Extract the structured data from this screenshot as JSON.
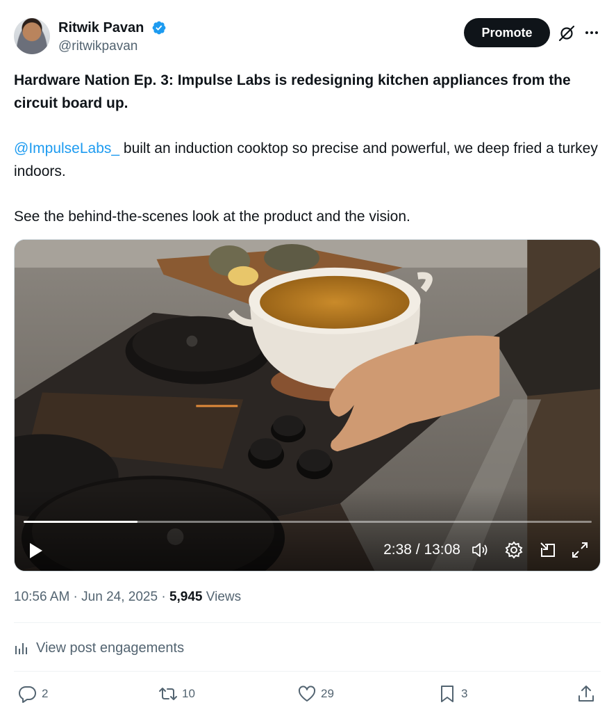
{
  "author": {
    "name": "Ritwik Pavan",
    "handle": "@ritwikpavan",
    "verified": true
  },
  "header_actions": {
    "promote_label": "Promote",
    "grok_icon": "grok-icon",
    "more_icon": "more-icon"
  },
  "post": {
    "title": "Hardware Nation Ep. 3: Impulse Labs is redesigning kitchen appliances from the circuit board up.",
    "mention": "@ImpulseLabs_",
    "body_line": " built an induction cooktop so precise and powerful, we deep fried a turkey indoors.",
    "closing": "See the behind-the-scenes look at the product and the vision."
  },
  "video": {
    "current_time": "2:38",
    "duration": "13:08",
    "time_display": "2:38 / 13:08",
    "progress_fraction": 0.201,
    "controls": [
      "play-icon",
      "volume-icon",
      "settings-icon",
      "pip-icon",
      "fullscreen-icon"
    ]
  },
  "meta": {
    "time": "10:56 AM",
    "date": "Jun 24, 2025",
    "views_count": "5,945",
    "views_label": "Views"
  },
  "engagements": {
    "label": "View post engagements"
  },
  "actions": {
    "replies": "2",
    "reposts": "10",
    "likes": "29",
    "bookmarks": "3"
  },
  "colors": {
    "accent": "#1d9bf0",
    "text_primary": "#0f1419",
    "text_secondary": "#536471",
    "button_dark": "#0f1419",
    "divider": "#eff3f4"
  }
}
